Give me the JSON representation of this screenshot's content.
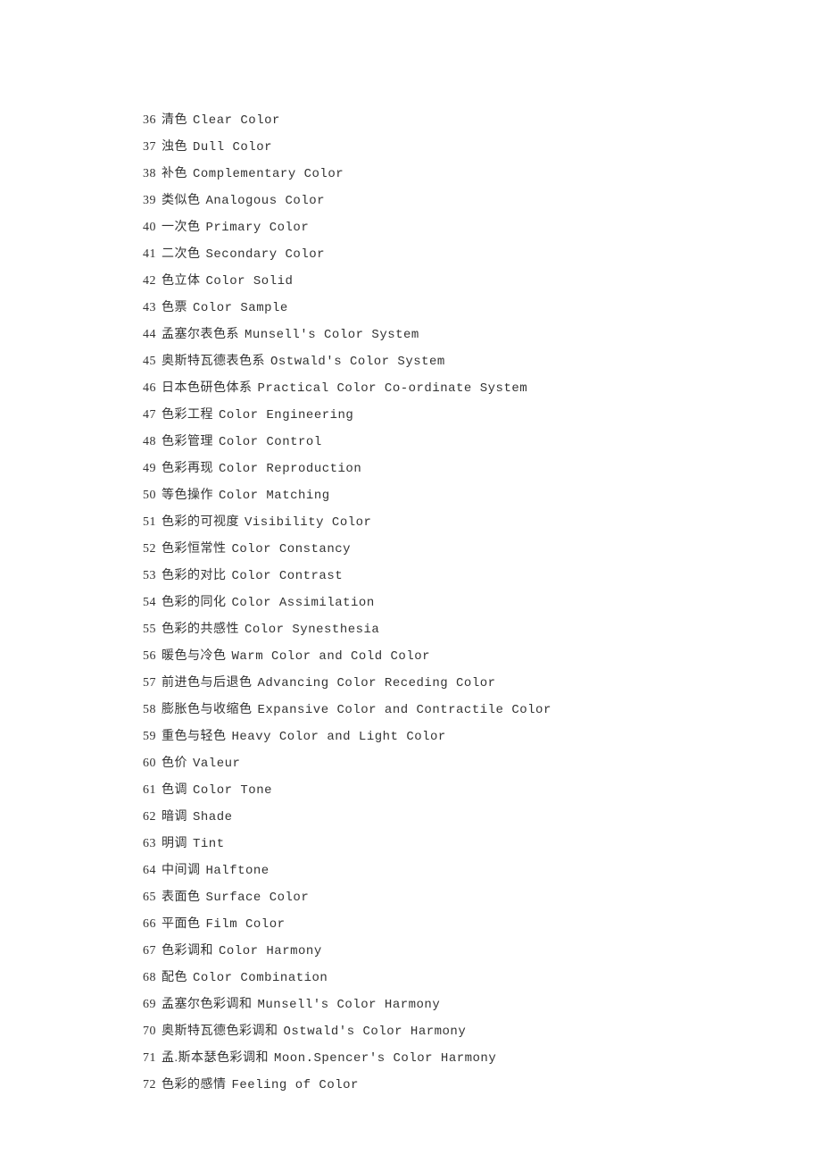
{
  "items": [
    {
      "num": "36",
      "cn": "清色",
      "en": "Clear Color"
    },
    {
      "num": "37",
      "cn": "浊色",
      "en": "Dull Color"
    },
    {
      "num": "38",
      "cn": "补色",
      "en": "Complementary Color"
    },
    {
      "num": "39",
      "cn": "类似色",
      "en": "Analogous Color"
    },
    {
      "num": "40",
      "cn": "一次色",
      "en": "Primary Color"
    },
    {
      "num": "41",
      "cn": "二次色",
      "en": "Secondary Color"
    },
    {
      "num": "42",
      "cn": "色立体",
      "en": "Color Solid"
    },
    {
      "num": "43",
      "cn": "色票",
      "en": "Color Sample"
    },
    {
      "num": "44",
      "cn": "孟塞尔表色系",
      "en": "Munsell's Color System"
    },
    {
      "num": "45",
      "cn": "奥斯特瓦德表色系",
      "en": "Ostwald's Color System"
    },
    {
      "num": "46",
      "cn": "日本色研色体系",
      "en": "Practical Color Co-ordinate System"
    },
    {
      "num": "47",
      "cn": "色彩工程",
      "en": "Color Engineering"
    },
    {
      "num": "48",
      "cn": "色彩管理",
      "en": "Color Control"
    },
    {
      "num": "49",
      "cn": "色彩再现",
      "en": "Color Reproduction"
    },
    {
      "num": "50",
      "cn": "等色操作",
      "en": "Color Matching"
    },
    {
      "num": "51",
      "cn": "色彩的可视度",
      "en": "Visibility Color"
    },
    {
      "num": "52",
      "cn": "色彩恒常性",
      "en": "Color Constancy"
    },
    {
      "num": "53",
      "cn": "色彩的对比",
      "en": "Color Contrast"
    },
    {
      "num": "54",
      "cn": "色彩的同化",
      "en": "Color Assimilation"
    },
    {
      "num": "55",
      "cn": "色彩的共感性",
      "en": "Color Synesthesia"
    },
    {
      "num": "56",
      "cn": "暖色与冷色",
      "en": "Warm Color and Cold Color"
    },
    {
      "num": "57",
      "cn": "前进色与后退色",
      "en": "Advancing Color Receding Color"
    },
    {
      "num": "58",
      "cn": "膨胀色与收缩色",
      "en": "Expansive Color and Contractile Color"
    },
    {
      "num": "59",
      "cn": "重色与轻色",
      "en": "Heavy Color and Light Color"
    },
    {
      "num": "60",
      "cn": "色价",
      "en": "Valeur"
    },
    {
      "num": "61",
      "cn": "色调",
      "en": "Color Tone"
    },
    {
      "num": "62",
      "cn": "暗调",
      "en": "Shade"
    },
    {
      "num": "63",
      "cn": "明调",
      "en": "Tint"
    },
    {
      "num": "64",
      "cn": "中间调",
      "en": "Halftone"
    },
    {
      "num": "65",
      "cn": "表面色",
      "en": "Surface Color"
    },
    {
      "num": "66",
      "cn": "平面色",
      "en": "Film Color"
    },
    {
      "num": "67",
      "cn": "色彩调和",
      "en": "Color Harmony"
    },
    {
      "num": "68",
      "cn": "配色",
      "en": "Color Combination"
    },
    {
      "num": "69",
      "cn": "孟塞尔色彩调和",
      "en": "Munsell's Color Harmony"
    },
    {
      "num": "70",
      "cn": "奥斯特瓦德色彩调和",
      "en": "Ostwald's Color Harmony"
    },
    {
      "num": "71",
      "cn": "孟.斯本瑟色彩调和",
      "en": "Moon.Spencer's Color Harmony"
    },
    {
      "num": "72",
      "cn": "色彩的感情",
      "en": "Feeling of Color"
    }
  ]
}
